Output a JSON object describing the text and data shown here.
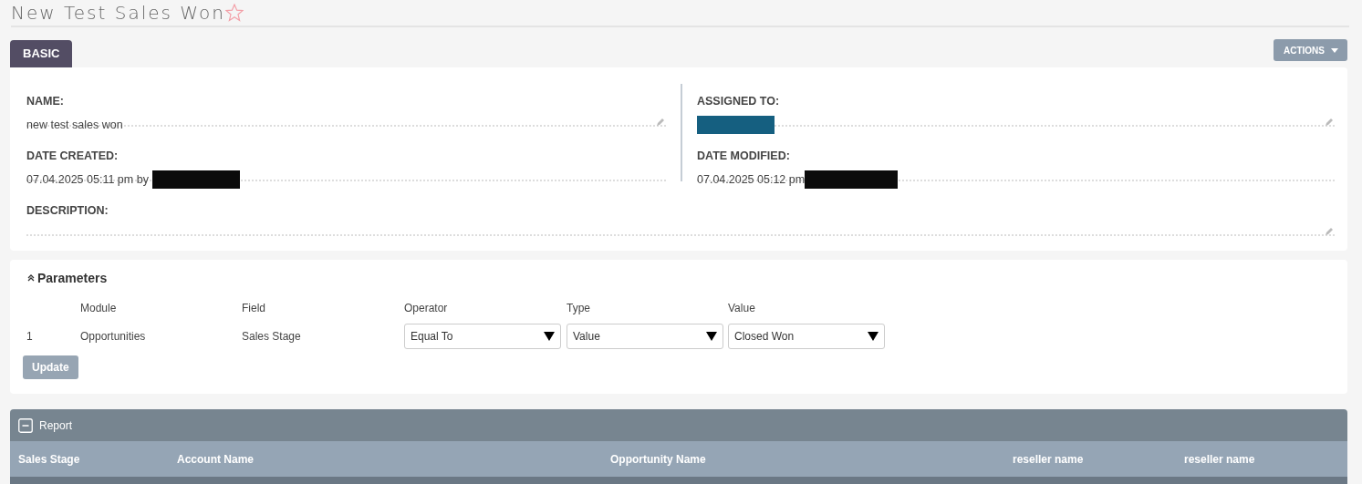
{
  "page": {
    "title": "New Test Sales Won",
    "favorite": false
  },
  "tabs": [
    {
      "label": "BASIC",
      "selected": true
    }
  ],
  "actions_button": {
    "label": "ACTIONS"
  },
  "fields": [
    {
      "label": "NAME:",
      "value": "new test sales won",
      "kind": "text",
      "editable": true
    },
    {
      "label": "ASSIGNED TO:",
      "kind": "link-redacted",
      "editable": true
    },
    {
      "label": "DATE CREATED:",
      "value": "07.04.2025 05:11 pm by",
      "kind": "redacted-suffix",
      "editable": false
    },
    {
      "label": "DATE MODIFIED:",
      "value": "07.04.2025 05:12 pm",
      "kind": "redacted-suffix",
      "editable": false
    },
    {
      "label": "DESCRIPTION:",
      "kind": "empty",
      "editable": true,
      "wide": true
    }
  ],
  "parameters": {
    "title": "Parameters",
    "expanded": true,
    "columns": [
      "Module",
      "Field",
      "Operator",
      "Type",
      "Value"
    ],
    "rows": [
      {
        "number": "1",
        "module": "Opportunities",
        "field": "Sales Stage",
        "operator": "Equal To",
        "type": "Value",
        "value": "Closed Won"
      }
    ],
    "button": "Update"
  },
  "report": {
    "title": "Report",
    "expanded": true,
    "columns": [
      "Sales Stage",
      "Account Name",
      "Opportunity Name",
      "reseller name",
      "reseller name"
    ]
  }
}
